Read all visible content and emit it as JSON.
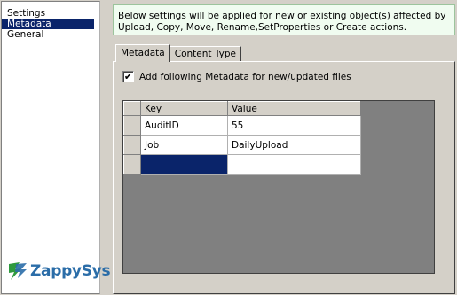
{
  "sidebar": {
    "items": [
      {
        "label": "Settings"
      },
      {
        "label": "Metadata"
      },
      {
        "label": "General"
      }
    ],
    "selected": "Metadata"
  },
  "brand": {
    "logo_text": "ZappySys",
    "colors": {
      "blue": "#2b6da8",
      "green": "#2e9a3e"
    }
  },
  "info": {
    "text": "Below settings will be applied for new or existing object(s) affected by Upload, Copy, Move, Rename,SetProperties or Create actions."
  },
  "tabs": [
    {
      "label": "Metadata",
      "active": true
    },
    {
      "label": "Content Type",
      "active": false
    }
  ],
  "metadata": {
    "checkbox_label": "Add following Metadata for new/updated files",
    "checked": true,
    "checkmark": "✔",
    "grid": {
      "columns": [
        "Key",
        "Value"
      ],
      "rows": [
        {
          "key": "AuditID",
          "value": "55"
        },
        {
          "key": "Job",
          "value": "DailyUpload"
        },
        {
          "key": "",
          "value": ""
        }
      ]
    }
  },
  "colors": {
    "selection": "#0a246a",
    "info_bg": "#f0fcf0",
    "window": "#d4d0c8"
  }
}
